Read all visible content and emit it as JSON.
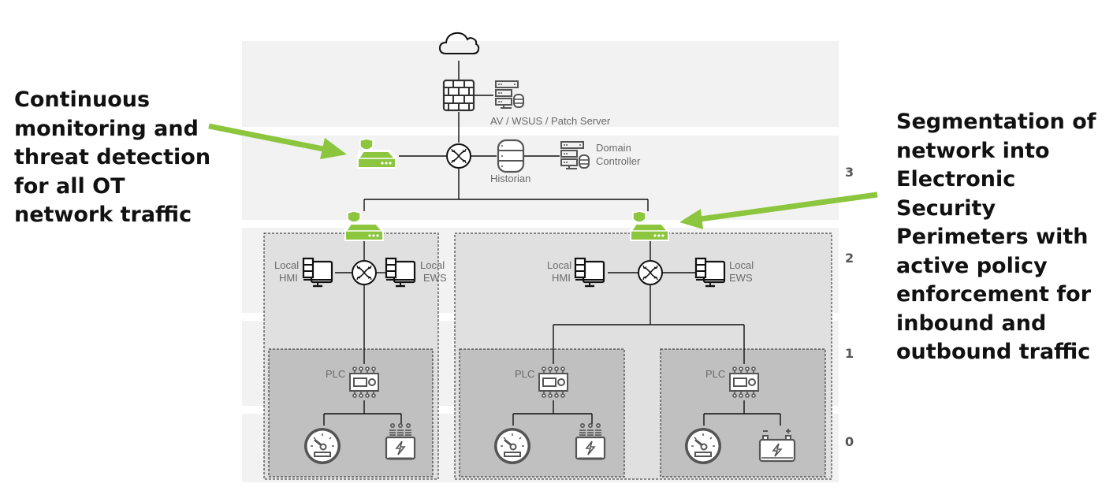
{
  "callouts": {
    "left": "Continuous monitoring and threat detection for all OT network traffic",
    "right": "Segmentation of network into Electronic Security Perimeters with active policy enforcement for inbound and outbound traffic"
  },
  "levels": [
    "3",
    "2",
    "1",
    "0"
  ],
  "labels": {
    "av_server": "AV / WSUS / Patch Server",
    "historian": "Historian",
    "domain_controller_1": "Domain",
    "domain_controller_2": "Controller",
    "local": "Local",
    "hmi": "HMI",
    "ews": "EWS",
    "plc": "PLC"
  },
  "colors": {
    "accent_green": "#8cc63f",
    "band": "#f2f2f2",
    "esp_box": "#e0e0e0",
    "inner_box": "#c0c0c0",
    "icon_gray": "#555555"
  }
}
